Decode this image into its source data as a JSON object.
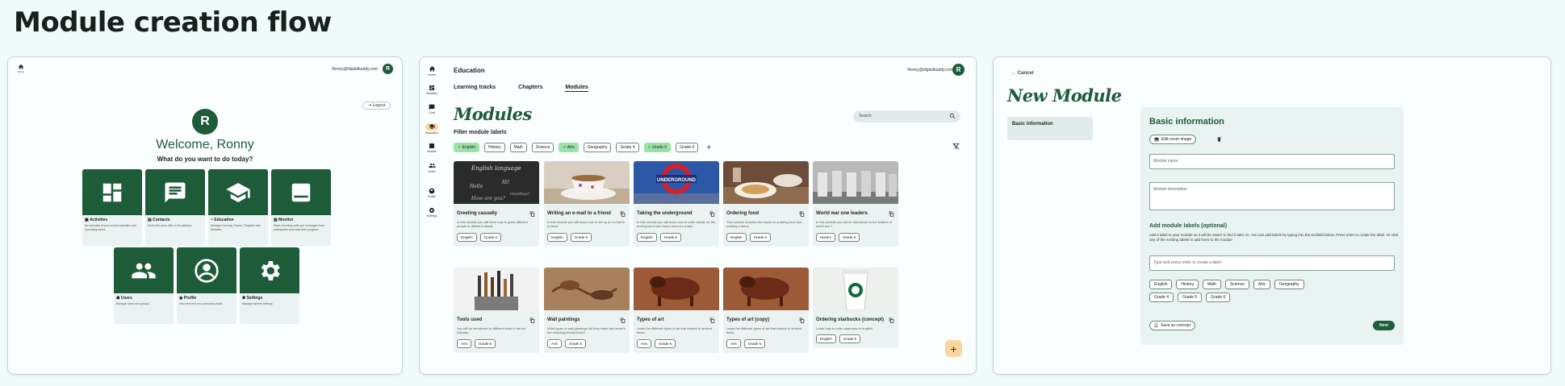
{
  "title": "Module creation flow",
  "frame1": {
    "home_label": "Home",
    "email": "Ronny@digitalbuddy.com",
    "avatar_initial": "R",
    "logout_label": "Logout",
    "welcome": "Welcome, Ronny",
    "question": "What do you want to do today?",
    "tiles": [
      {
        "title": "Activities",
        "desc": "An overview of your current activities and upcoming tracks",
        "icon": "dashboard-icon"
      },
      {
        "title": "Contacts",
        "desc": "Chat with users with in the platform",
        "icon": "chat-icon"
      },
      {
        "title": "Education",
        "desc": "Manage Learning Tracks, Chapters and Modules",
        "icon": "graduation-cap-icon"
      },
      {
        "title": "Monitor",
        "desc": "Store incoming calls and messages from participants and track their progress",
        "icon": "monitor-icon"
      },
      {
        "title": "Users",
        "desc": "Manage users and groups",
        "icon": "users-icon"
      },
      {
        "title": "Profile",
        "desc": "View and edit your personal profile",
        "icon": "profile-icon"
      },
      {
        "title": "Settings",
        "desc": "Manage system settings",
        "icon": "gear-icon"
      }
    ]
  },
  "frame2": {
    "sidebar": [
      "Home",
      "Activities",
      "Chat",
      "Education",
      "Monitor",
      "Users",
      "Profile",
      "Settings"
    ],
    "section": "Education",
    "email": "Ronny@digitalbuddy.com",
    "avatar_initial": "R",
    "tabs": [
      "Learning tracks",
      "Chapters",
      "Modules"
    ],
    "heading": "Modules",
    "search_placeholder": "Search",
    "filter_title": "Filter module labels",
    "filters": [
      {
        "label": "English",
        "selected": true
      },
      {
        "label": "History",
        "selected": false
      },
      {
        "label": "Math",
        "selected": false
      },
      {
        "label": "Science",
        "selected": false
      },
      {
        "label": "Arts",
        "selected": true
      },
      {
        "label": "Geography",
        "selected": false
      },
      {
        "label": "Grade 4",
        "selected": false
      },
      {
        "label": "Grade 5",
        "selected": true
      },
      {
        "label": "Grade 6",
        "selected": false
      }
    ],
    "check": "✓",
    "cards": [
      {
        "title": "Greeting casually",
        "desc": "In this module you will learn how to greet different people in different casual",
        "tags": [
          "English",
          "Grade 5"
        ]
      },
      {
        "title": "Writing an e-mail to a friend",
        "desc": "In this module you will learn how to set up an e-mail to a friend",
        "tags": [
          "English",
          "Grade 5"
        ]
      },
      {
        "title": "Taking the underground",
        "desc": "In this module you will learn how to order tickets for the underground and travel around London",
        "tags": [
          "English",
          "Grade 5"
        ],
        "img_text": "UNDERGROUND"
      },
      {
        "title": "Ordering food",
        "desc": "This module includes the basics in ordering food and reading a menu",
        "tags": [
          "English",
          "Grade 5"
        ]
      },
      {
        "title": "World war one leaders",
        "desc": "In this module you will be introduced to the leaders of world war 1",
        "tags": [
          "History",
          "Grade 5"
        ]
      },
      {
        "title": "Tools used",
        "desc": "You will be introduced to different tools in the art industry",
        "tags": [
          "Arts",
          "Grade 5"
        ]
      },
      {
        "title": "Wall paintings",
        "desc": "What types of wall paintings did they make and what is the meaning behind them?",
        "tags": [
          "Arts",
          "Grade 5"
        ]
      },
      {
        "title": "Types of art",
        "desc": "Learn the different types of art that existed in ancient times",
        "tags": [
          "Arts",
          "Grade 5"
        ]
      },
      {
        "title": "Types of art (copy)",
        "desc": "Learn the different types of art that existed in ancient times",
        "tags": [
          "Arts",
          "Grade 5"
        ]
      },
      {
        "title": "Ordering starbucks (concept)",
        "desc": "Learn how to order starbucks in english",
        "tags": [
          "English",
          "Grade 5"
        ]
      }
    ],
    "chalk_lines": [
      "English language",
      "Hello",
      "Hi!",
      "Goodbye!",
      "How are you?"
    ],
    "fab_label": "+",
    "colors": {
      "accent": "#1e5b38",
      "chip_selected": "#9ce2a7",
      "fab": "#f8d89d"
    }
  },
  "frame3": {
    "cancel": "Cancel",
    "heading": "New Module",
    "nav_item": "Basic information",
    "panel_title": "Basic information",
    "edit_cover": "Edit cover image",
    "name_placeholder": "Module name",
    "desc_placeholder": "Module description",
    "labels_title": "Add module labels (optional)",
    "labels_help": "Add a label to your module so it will be easier to find it later on. You can add labels by typing into the textfield below. Press enter to create the label. Or click any of the existing labels to add them to the module",
    "label_placeholder": "Type and press enter to create a label",
    "labels_row1": [
      "English",
      "History",
      "Math",
      "Science",
      "Arts",
      "Geography"
    ],
    "labels_row2": [
      "Grade 4",
      "Grade 5",
      "Grade 6"
    ],
    "save_concept": "Save as concept",
    "next": "Next"
  }
}
